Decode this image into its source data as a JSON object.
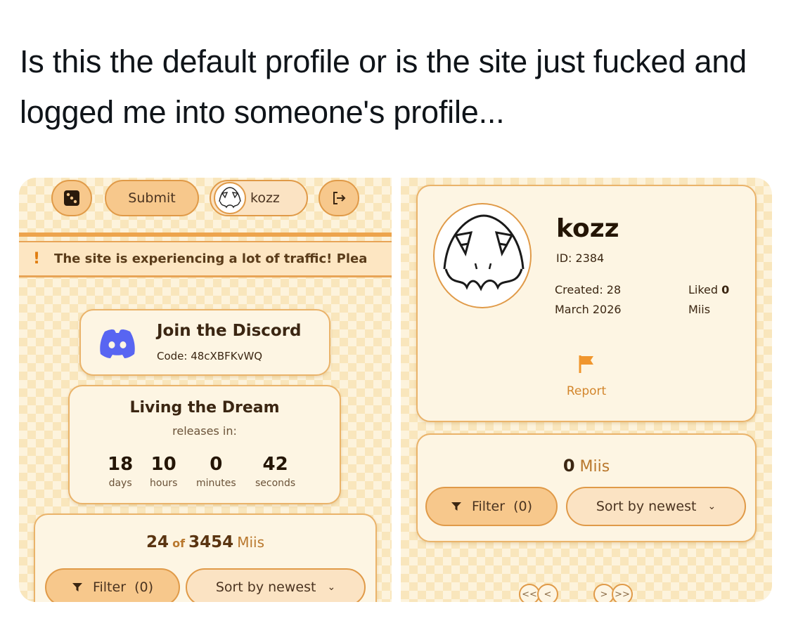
{
  "post": {
    "text": "Is this the default profile or is the site just fucked and logged me into someone's profile..."
  },
  "left": {
    "topbar": {
      "submit_label": "Submit",
      "username": "kozz"
    },
    "banner": {
      "text": "The site is experiencing a lot of traffic! Plea"
    },
    "discord": {
      "title": "Join the Discord",
      "code": "Code: 48cXBFKvWQ"
    },
    "countdown": {
      "title": "Living the Dream",
      "subtitle": "releases in:",
      "units": [
        {
          "value": "18",
          "label": "days"
        },
        {
          "value": "10",
          "label": "hours"
        },
        {
          "value": "0",
          "label": "minutes"
        },
        {
          "value": "42",
          "label": "seconds"
        }
      ]
    },
    "miis": {
      "shown": "24",
      "of": "of",
      "total": "3454",
      "unit": "Miis",
      "filter_label": "Filter",
      "filter_count": "(0)",
      "sort_label": "Sort by newest"
    }
  },
  "right": {
    "profile": {
      "name": "kozz",
      "id": "ID: 2384",
      "created": "Created: 28 March 2026",
      "liked_prefix": "Liked",
      "liked_count": "0",
      "liked_suffix": "Miis",
      "report_label": "Report"
    },
    "miis": {
      "count": "0",
      "unit": "Miis",
      "filter_label": "Filter",
      "filter_count": "(0)",
      "sort_label": "Sort by newest"
    },
    "pager": {
      "first": "<<",
      "prev": "<",
      "next": ">",
      "last": ">>"
    }
  },
  "colors": {
    "accent": "#e09a48",
    "pill_bg": "#f7c88c",
    "card_bg": "#fdf5e3",
    "discord": "#5865f2",
    "report": "#f0962e"
  }
}
